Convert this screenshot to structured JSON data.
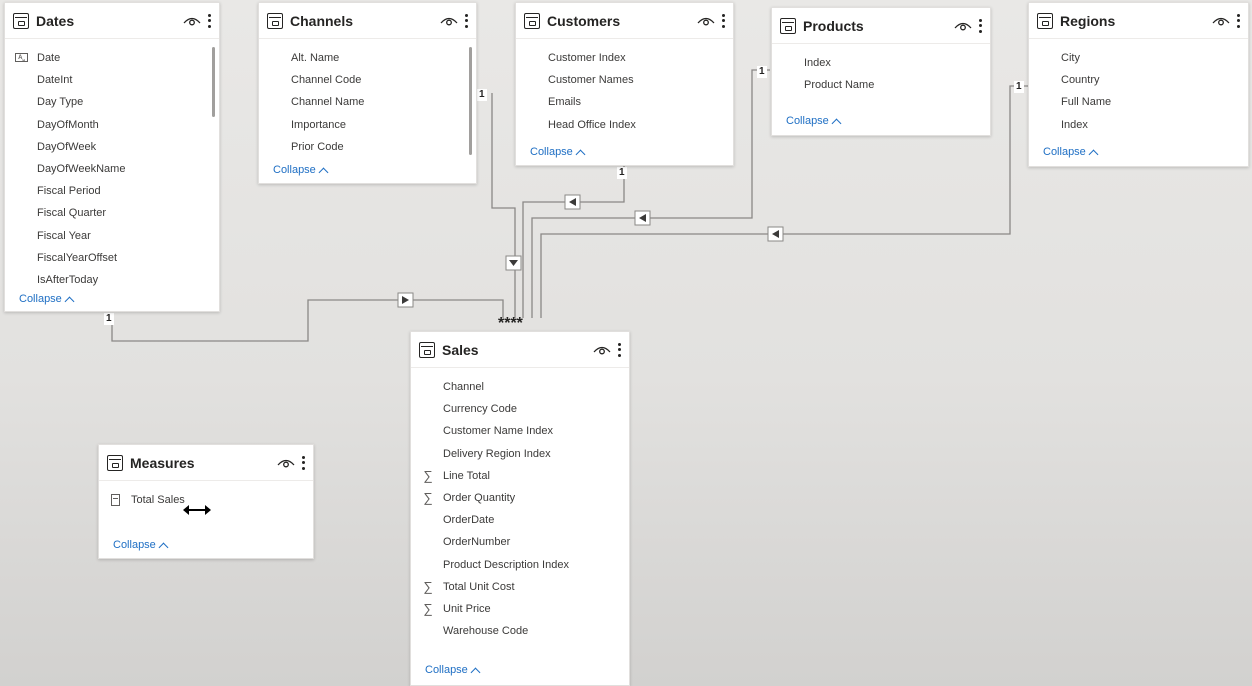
{
  "tables": {
    "dates": {
      "title": "Dates",
      "fields": [
        "Date",
        "DateInt",
        "Day Type",
        "DayOfMonth",
        "DayOfWeek",
        "DayOfWeekName",
        "Fiscal Period",
        "Fiscal Quarter",
        "Fiscal Year",
        "FiscalYearOffset",
        "IsAfterToday"
      ],
      "collapse": "Collapse"
    },
    "channels": {
      "title": "Channels",
      "fields": [
        "Alt. Name",
        "Channel Code",
        "Channel Name",
        "Importance",
        "Prior Code"
      ],
      "collapse": "Collapse"
    },
    "customers": {
      "title": "Customers",
      "fields": [
        "Customer Index",
        "Customer Names",
        "Emails",
        "Head Office Index"
      ],
      "collapse": "Collapse"
    },
    "products": {
      "title": "Products",
      "fields": [
        "Index",
        "Product Name"
      ],
      "collapse": "Collapse"
    },
    "regions": {
      "title": "Regions",
      "fields": [
        "City",
        "Country",
        "Full Name",
        "Index"
      ],
      "collapse": "Collapse"
    },
    "sales": {
      "title": "Sales",
      "fields": [
        "Channel",
        "Currency Code",
        "Customer Name Index",
        "Delivery Region Index",
        "Line Total",
        "Order Quantity",
        "OrderDate",
        "OrderNumber",
        "Product Description Index",
        "Total Unit Cost",
        "Unit Price",
        "Warehouse Code"
      ],
      "collapse": "Collapse"
    },
    "measures": {
      "title": "Measures",
      "fields": [
        "Total Sales"
      ],
      "collapse": "Collapse"
    }
  },
  "relationships": {
    "one_label": "1",
    "many_label": "*",
    "sales_many_markers": "****"
  },
  "colors": {
    "link": "#1f6fc4",
    "line": "#807e7c",
    "card": "#ffffff"
  }
}
